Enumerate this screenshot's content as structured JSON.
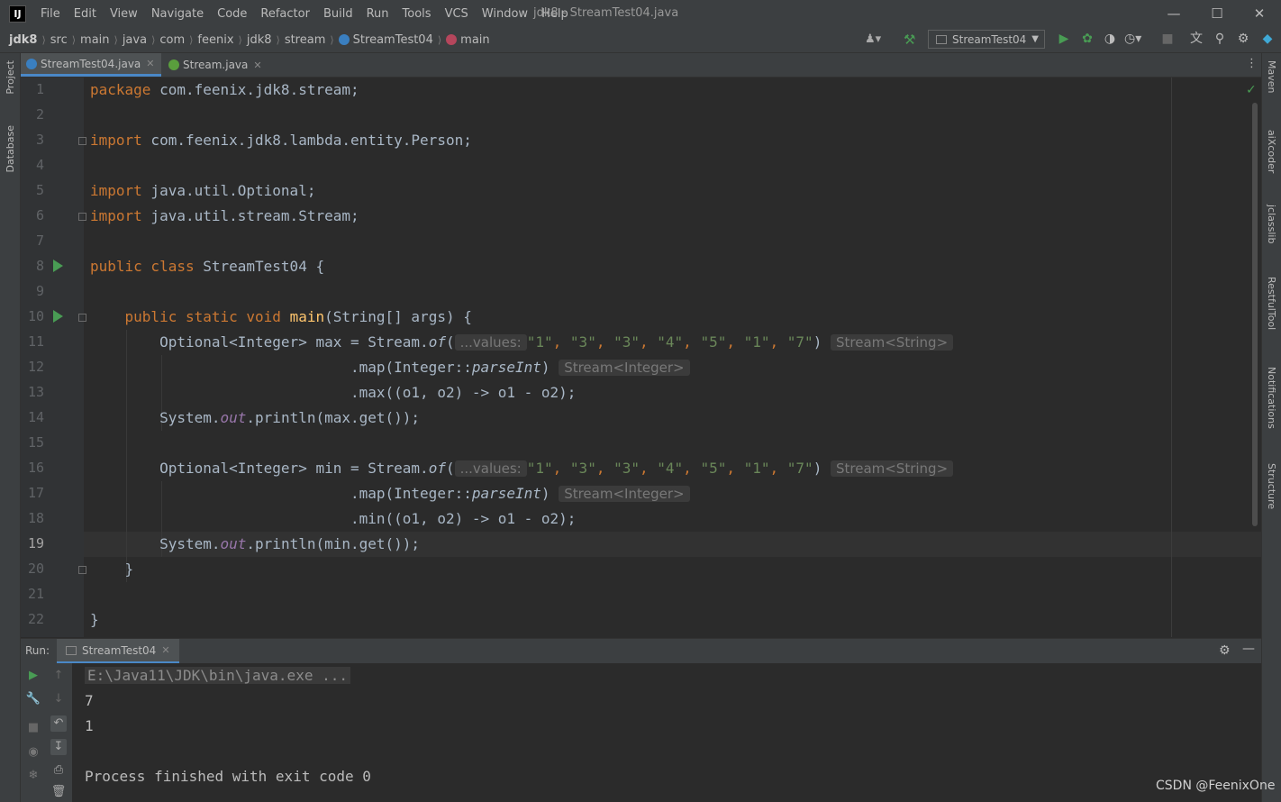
{
  "window": {
    "title": "jdk8 - StreamTest04.java",
    "menus": [
      "File",
      "Edit",
      "View",
      "Navigate",
      "Code",
      "Refactor",
      "Build",
      "Run",
      "Tools",
      "VCS",
      "Window",
      "Help"
    ]
  },
  "breadcrumbs": [
    "jdk8",
    "src",
    "main",
    "java",
    "com",
    "feenix",
    "jdk8",
    "stream",
    "StreamTest04",
    "main"
  ],
  "run_config": "StreamTest04",
  "tabs": [
    {
      "label": "StreamTest04.java",
      "active": true,
      "icon": "class-icon"
    },
    {
      "label": "Stream.java",
      "active": false,
      "icon": "interface-icon"
    }
  ],
  "left_stripe": [
    "Project",
    "Database"
  ],
  "right_stripe": [
    "Maven",
    "aiXcoder",
    "jclasslib",
    "RestfulTool",
    "Notifications",
    "Structure"
  ],
  "editor": {
    "current_line": 19,
    "line_numbers": [
      "1",
      "2",
      "3",
      "4",
      "5",
      "6",
      "7",
      "8",
      "9",
      "10",
      "11",
      "12",
      "13",
      "14",
      "15",
      "16",
      "17",
      "18",
      "19",
      "20",
      "21",
      "22"
    ],
    "lines": {
      "l1_kw": "package",
      "l1_rest": " com.feenix.jdk8.stream;",
      "l3_kw": "import",
      "l3_rest": " com.feenix.jdk8.lambda.entity.Person;",
      "l5_kw": "import",
      "l5_rest": " java.util.Optional;",
      "l6_kw": "import",
      "l6_rest": " java.util.stream.Stream;",
      "l8_kw": "public class",
      "l8_rest": " StreamTest04 {",
      "l10_kw": "public static void",
      "l10_fn": "main",
      "l10_rest": "(String[] args) {",
      "l11_a": "Optional<Integer> max = Stream.",
      "l11_of": "of",
      "l11_paren": "(",
      "l11_hint": "...values:",
      "l11_args": [
        "\"1\"",
        "\"3\"",
        "\"3\"",
        "\"4\"",
        "\"5\"",
        "\"1\"",
        "\"7\""
      ],
      "l11_close": ")",
      "l11_type": "Stream<String>",
      "l12_a": ".map(Integer::",
      "l12_it": "parseInt",
      "l12_close": ")",
      "l12_type": "Stream<Integer>",
      "l13": ".max((o1, o2) -> o1 - o2);",
      "l14_a": "System.",
      "l14_out": "out",
      "l14_b": ".println(max.get());",
      "l16_a": "Optional<Integer> min = Stream.",
      "l16_of": "of",
      "l16_paren": "(",
      "l16_hint": "...values:",
      "l16_args": [
        "\"1\"",
        "\"3\"",
        "\"3\"",
        "\"4\"",
        "\"5\"",
        "\"1\"",
        "\"7\""
      ],
      "l16_close": ")",
      "l16_type": "Stream<String>",
      "l17_a": ".map(Integer::",
      "l17_it": "parseInt",
      "l17_close": ")",
      "l17_type": "Stream<Integer>",
      "l18": ".min((o1, o2) -> o1 - o2);",
      "l19_a": "System.",
      "l19_out": "out",
      "l19_b": ".println(min.get());",
      "l20": "}",
      "l22": "}"
    }
  },
  "run_panel": {
    "label": "Run:",
    "tab": "StreamTest04",
    "output": {
      "cmd": "E:\\Java11\\JDK\\bin\\java.exe ...",
      "line1": "7",
      "line2": "1",
      "finish": "Process finished with exit code 0"
    }
  },
  "watermark": "CSDN @FeenixOne",
  "colors": {
    "keyword": "#cc7832",
    "string": "#6a8759",
    "function": "#ffc66d",
    "static_field": "#9876aa",
    "run_green": "#499c54",
    "accent": "#4a88c7"
  }
}
